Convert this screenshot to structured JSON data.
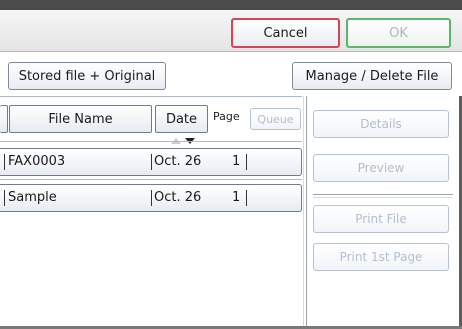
{
  "header": {
    "cancel_label": "Cancel",
    "ok_label": "OK"
  },
  "toolbar": {
    "stored_label": "Stored file + Original",
    "manage_label": "Manage / Delete File"
  },
  "columns": {
    "file_name": "File Name",
    "date": "Date",
    "page": "Page",
    "queue": "Queue"
  },
  "files": [
    {
      "name": "FAX0003",
      "date": "Oct. 26",
      "pages": "1"
    },
    {
      "name": "Sample",
      "date": "Oct. 26",
      "pages": "1"
    }
  ],
  "side_actions": {
    "details": "Details",
    "preview": "Preview",
    "print_file": "Print File",
    "print_first_page": "Print 1st Page"
  },
  "colors": {
    "cancel_border": "#d94455",
    "ok_border": "#57b86a",
    "disabled_text": "#b3bfcc"
  }
}
